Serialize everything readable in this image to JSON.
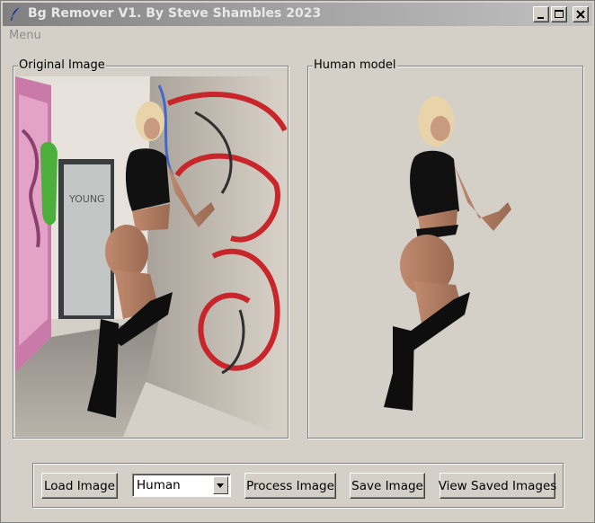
{
  "window": {
    "title": "Bg Remover V1. By Steve Shambles 2023",
    "app_icon": "feather-icon",
    "controls": [
      "minimize-icon",
      "maximize-icon",
      "close-icon"
    ]
  },
  "menubar": {
    "menu_label": "Menu"
  },
  "panels": {
    "original": {
      "label": "Original Image",
      "content": "photo"
    },
    "result": {
      "label": "Human model",
      "content": "cutout"
    }
  },
  "toolbar": {
    "load_label": "Load Image",
    "model_selected": "Human",
    "process_label": "Process Image",
    "save_label": "Save Image",
    "view_saved_label": "View Saved Images"
  },
  "colors": {
    "window_bg": "#d4d0c8",
    "titlebar_start": "#808080",
    "titlebar_end": "#c0c0c0"
  }
}
